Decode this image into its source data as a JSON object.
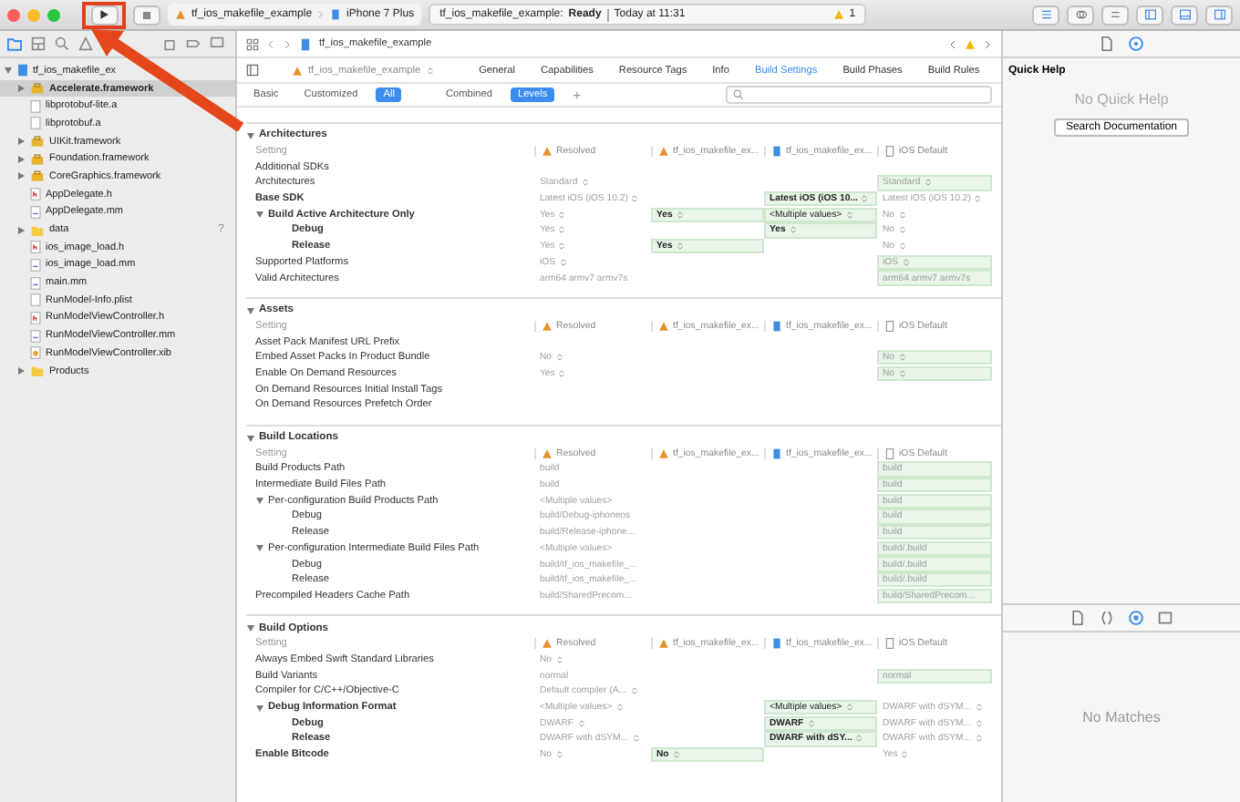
{
  "toolbar": {
    "scheme": "tf_ios_makefile_example",
    "device": "iPhone 7 Plus",
    "activity_project": "tf_ios_makefile_example:",
    "activity_status": "Ready",
    "activity_time": "Today at 11:31",
    "warning_count": "1"
  },
  "navigator_tabs": [
    {
      "kind": "folder",
      "selected": true
    },
    {
      "kind": "hierarchy",
      "selected": false
    },
    {
      "kind": "search",
      "selected": false
    },
    {
      "kind": "warning",
      "selected": false
    },
    {
      "kind": "debug",
      "selected": false
    },
    {
      "kind": "breakpoint",
      "selected": false
    },
    {
      "kind": "report",
      "selected": false
    }
  ],
  "project_tree": {
    "name": "tf_ios_makefile_ex",
    "kind": "project",
    "expanded": true,
    "selected": false,
    "children": [
      {
        "name": "Accelerate.framework",
        "kind": "framework",
        "expanded": false,
        "selected": true
      },
      {
        "name": "libprotobuf-lite.a",
        "kind": "file",
        "selected": false
      },
      {
        "name": "libprotobuf.a",
        "kind": "file",
        "selected": false
      },
      {
        "name": "UIKit.framework",
        "kind": "framework",
        "expanded": false,
        "selected": false
      },
      {
        "name": "Foundation.framework",
        "kind": "framework",
        "expanded": false,
        "selected": false
      },
      {
        "name": "CoreGraphics.framework",
        "kind": "framework",
        "expanded": false,
        "selected": false
      },
      {
        "name": "AppDelegate.h",
        "kind": "header",
        "selected": false
      },
      {
        "name": "AppDelegate.mm",
        "kind": "source",
        "selected": false
      },
      {
        "name": "data",
        "kind": "folder",
        "expanded": false,
        "selected": false,
        "badge": "?"
      },
      {
        "name": "ios_image_load.h",
        "kind": "header",
        "selected": false
      },
      {
        "name": "ios_image_load.mm",
        "kind": "source",
        "selected": false
      },
      {
        "name": "main.mm",
        "kind": "source",
        "selected": false
      },
      {
        "name": "RunModel-Info.plist",
        "kind": "file",
        "selected": false
      },
      {
        "name": "RunModelViewController.h",
        "kind": "header",
        "selected": false
      },
      {
        "name": "RunModelViewController.mm",
        "kind": "source",
        "selected": false
      },
      {
        "name": "RunModelViewController.xib",
        "kind": "xib",
        "selected": false
      },
      {
        "name": "Products",
        "kind": "folder",
        "expanded": false,
        "selected": false
      }
    ]
  },
  "editor": {
    "jump_path": "tf_ios_makefile_example",
    "target_selector": "tf_ios_makefile_example",
    "tabs": [
      {
        "label": "General",
        "selected": false
      },
      {
        "label": "Capabilities",
        "selected": false
      },
      {
        "label": "Resource Tags",
        "selected": false
      },
      {
        "label": "Info",
        "selected": false
      },
      {
        "label": "Build Settings",
        "selected": true
      },
      {
        "label": "Build Phases",
        "selected": false
      },
      {
        "label": "Build Rules",
        "selected": false
      }
    ],
    "scope_filters": [
      {
        "label": "Basic",
        "selected": false
      },
      {
        "label": "Customized",
        "selected": false
      },
      {
        "label": "All",
        "selected": true
      }
    ],
    "view_filters": [
      {
        "label": "Combined",
        "selected": false
      },
      {
        "label": "Levels",
        "selected": true
      }
    ],
    "add_button": "+",
    "sections": [
      {
        "title": "Architectures",
        "expanded": true,
        "header": {
          "setting": "Setting",
          "columns": [
            {
              "text": "Resolved",
              "kind": "resolved"
            },
            {
              "text": "tf_ios_makefile_ex...",
              "kind": "target"
            },
            {
              "text": "tf_ios_makefile_ex...",
              "kind": "project"
            },
            {
              "text": "iOS Default",
              "kind": "default"
            }
          ]
        },
        "rows": [
          {
            "name": "Additional SDKs",
            "bold": false,
            "cells": [
              null,
              null,
              null,
              null
            ]
          },
          {
            "name": "Architectures",
            "bold": false,
            "cells": [
              {
                "text": "Standard",
                "popup": true,
                "highlighted": false,
                "greyed": true,
                "bold": false
              },
              null,
              null,
              {
                "text": "Standard",
                "popup": true,
                "highlighted": true,
                "greyed": true,
                "bold": false
              }
            ]
          },
          {
            "name": "Base SDK",
            "bold": true,
            "cells": [
              {
                "text": "Latest iOS (iOS 10.2)",
                "popup": true,
                "highlighted": false,
                "greyed": true,
                "bold": false
              },
              null,
              {
                "text": "Latest iOS (iOS 10...",
                "popup": true,
                "highlighted": true,
                "greyed": false,
                "bold": true
              },
              {
                "text": "Latest iOS (iOS 10.2)",
                "popup": true,
                "highlighted": false,
                "greyed": true,
                "bold": false
              }
            ]
          },
          {
            "name": "Build Active Architecture Only",
            "bold": true,
            "expanded": true,
            "cells": [
              {
                "text": "Yes",
                "popup": true,
                "highlighted": false,
                "greyed": true,
                "bold": false
              },
              {
                "text": "Yes",
                "popup": true,
                "highlighted": true,
                "greyed": false,
                "bold": true
              },
              {
                "text": "<Multiple values>",
                "popup": true,
                "highlighted": true,
                "greyed": false,
                "bold": false
              },
              {
                "text": "No",
                "popup": true,
                "highlighted": false,
                "greyed": true,
                "bold": false
              }
            ],
            "children": [
              {
                "name": "Debug",
                "bold": true,
                "cells": [
                  {
                    "text": "Yes",
                    "popup": true,
                    "highlighted": false,
                    "greyed": true,
                    "bold": false
                  },
                  null,
                  {
                    "text": "Yes",
                    "popup": true,
                    "highlighted": true,
                    "greyed": false,
                    "bold": true
                  },
                  {
                    "text": "No",
                    "popup": true,
                    "highlighted": false,
                    "greyed": true,
                    "bold": false
                  }
                ]
              },
              {
                "name": "Release",
                "bold": true,
                "cells": [
                  {
                    "text": "Yes",
                    "popup": true,
                    "highlighted": false,
                    "greyed": true,
                    "bold": false
                  },
                  {
                    "text": "Yes",
                    "popup": true,
                    "highlighted": true,
                    "greyed": false,
                    "bold": true
                  },
                  null,
                  {
                    "text": "No",
                    "popup": true,
                    "highlighted": false,
                    "greyed": true,
                    "bold": false
                  }
                ]
              }
            ]
          },
          {
            "name": "Supported Platforms",
            "bold": false,
            "cells": [
              {
                "text": "iOS",
                "popup": true,
                "highlighted": false,
                "greyed": true,
                "bold": false
              },
              null,
              null,
              {
                "text": "iOS",
                "popup": true,
                "highlighted": true,
                "greyed": true,
                "bold": false
              }
            ]
          },
          {
            "name": "Valid Architectures",
            "bold": false,
            "cells": [
              {
                "text": "arm64 armv7 armv7s",
                "popup": false,
                "highlighted": false,
                "greyed": true,
                "bold": false
              },
              null,
              null,
              {
                "text": "arm64 armv7 armv7s",
                "popup": false,
                "highlighted": true,
                "greyed": true,
                "bold": false
              }
            ]
          }
        ]
      },
      {
        "title": "Assets",
        "expanded": true,
        "header": {
          "setting": "Setting",
          "columns": [
            {
              "text": "Resolved",
              "kind": "resolved"
            },
            {
              "text": "tf_ios_makefile_ex...",
              "kind": "target"
            },
            {
              "text": "tf_ios_makefile_ex...",
              "kind": "project"
            },
            {
              "text": "iOS Default",
              "kind": "default"
            }
          ]
        },
        "rows": [
          {
            "name": "Asset Pack Manifest URL Prefix",
            "bold": false,
            "cells": [
              null,
              null,
              null,
              null
            ]
          },
          {
            "name": "Embed Asset Packs In Product Bundle",
            "bold": false,
            "cells": [
              {
                "text": "No",
                "popup": true,
                "highlighted": false,
                "greyed": true,
                "bold": false
              },
              null,
              null,
              {
                "text": "No",
                "popup": true,
                "highlighted": true,
                "greyed": true,
                "bold": false
              }
            ]
          },
          {
            "name": "Enable On Demand Resources",
            "bold": false,
            "cells": [
              {
                "text": "Yes",
                "popup": true,
                "highlighted": false,
                "greyed": true,
                "bold": false
              },
              null,
              null,
              {
                "text": "No",
                "popup": true,
                "highlighted": true,
                "greyed": true,
                "bold": false
              }
            ]
          },
          {
            "name": "On Demand Resources Initial Install Tags",
            "bold": false,
            "cells": [
              null,
              null,
              null,
              null
            ]
          },
          {
            "name": "On Demand Resources Prefetch Order",
            "bold": false,
            "cells": [
              null,
              null,
              null,
              null
            ]
          }
        ]
      },
      {
        "title": "Build Locations",
        "expanded": true,
        "header": {
          "setting": "Setting",
          "columns": [
            {
              "text": "Resolved",
              "kind": "resolved"
            },
            {
              "text": "tf_ios_makefile_ex...",
              "kind": "target"
            },
            {
              "text": "tf_ios_makefile_ex...",
              "kind": "project"
            },
            {
              "text": "iOS Default",
              "kind": "default"
            }
          ]
        },
        "rows": [
          {
            "name": "Build Products Path",
            "bold": false,
            "cells": [
              {
                "text": "build",
                "popup": false,
                "highlighted": false,
                "greyed": true,
                "bold": false
              },
              null,
              null,
              {
                "text": "build",
                "popup": false,
                "highlighted": true,
                "greyed": true,
                "bold": false
              }
            ]
          },
          {
            "name": "Intermediate Build Files Path",
            "bold": false,
            "cells": [
              {
                "text": "build",
                "popup": false,
                "highlighted": false,
                "greyed": true,
                "bold": false
              },
              null,
              null,
              {
                "text": "build",
                "popup": false,
                "highlighted": true,
                "greyed": true,
                "bold": false
              }
            ]
          },
          {
            "name": "Per-configuration Build Products Path",
            "bold": false,
            "expanded": true,
            "cells": [
              {
                "text": "<Multiple values>",
                "popup": false,
                "highlighted": false,
                "greyed": true,
                "bold": false
              },
              null,
              null,
              {
                "text": "build",
                "popup": false,
                "highlighted": true,
                "greyed": true,
                "bold": false
              }
            ],
            "children": [
              {
                "name": "Debug",
                "bold": false,
                "cells": [
                  {
                    "text": "build/Debug-iphoneos",
                    "popup": false,
                    "highlighted": false,
                    "greyed": true,
                    "bold": false
                  },
                  null,
                  null,
                  {
                    "text": "build",
                    "popup": false,
                    "highlighted": true,
                    "greyed": true,
                    "bold": false
                  }
                ]
              },
              {
                "name": "Release",
                "bold": false,
                "cells": [
                  {
                    "text": "build/Release-iphone...",
                    "popup": false,
                    "highlighted": false,
                    "greyed": true,
                    "bold": false
                  },
                  null,
                  null,
                  {
                    "text": "build",
                    "popup": false,
                    "highlighted": true,
                    "greyed": true,
                    "bold": false
                  }
                ]
              }
            ]
          },
          {
            "name": "Per-configuration Intermediate Build Files Path",
            "bold": false,
            "expanded": true,
            "cells": [
              {
                "text": "<Multiple values>",
                "popup": false,
                "highlighted": false,
                "greyed": true,
                "bold": false
              },
              null,
              null,
              {
                "text": "build/.build",
                "popup": false,
                "highlighted": true,
                "greyed": true,
                "bold": false
              }
            ],
            "children": [
              {
                "name": "Debug",
                "bold": false,
                "cells": [
                  {
                    "text": "build/tf_ios_makefile_...",
                    "popup": false,
                    "highlighted": false,
                    "greyed": true,
                    "bold": false
                  },
                  null,
                  null,
                  {
                    "text": "build/.build",
                    "popup": false,
                    "highlighted": true,
                    "greyed": true,
                    "bold": false
                  }
                ]
              },
              {
                "name": "Release",
                "bold": false,
                "cells": [
                  {
                    "text": "build/tf_ios_makefile_...",
                    "popup": false,
                    "highlighted": false,
                    "greyed": true,
                    "bold": false
                  },
                  null,
                  null,
                  {
                    "text": "build/.build",
                    "popup": false,
                    "highlighted": true,
                    "greyed": true,
                    "bold": false
                  }
                ]
              }
            ]
          },
          {
            "name": "Precompiled Headers Cache Path",
            "bold": false,
            "cells": [
              {
                "text": "build/SharedPrecom...",
                "popup": false,
                "highlighted": false,
                "greyed": true,
                "bold": false
              },
              null,
              null,
              {
                "text": "build/SharedPrecom...",
                "popup": false,
                "highlighted": true,
                "greyed": true,
                "bold": false
              }
            ]
          }
        ]
      },
      {
        "title": "Build Options",
        "expanded": true,
        "header": {
          "setting": "Setting",
          "columns": [
            {
              "text": "Resolved",
              "kind": "resolved"
            },
            {
              "text": "tf_ios_makefile_ex...",
              "kind": "target"
            },
            {
              "text": "tf_ios_makefile_ex...",
              "kind": "project"
            },
            {
              "text": "iOS Default",
              "kind": "default"
            }
          ]
        },
        "rows": [
          {
            "name": "Always Embed Swift Standard Libraries",
            "bold": false,
            "cells": [
              {
                "text": "No",
                "popup": true,
                "highlighted": false,
                "greyed": true,
                "bold": false
              },
              null,
              null,
              null
            ]
          },
          {
            "name": "Build Variants",
            "bold": false,
            "cells": [
              {
                "text": "normal",
                "popup": false,
                "highlighted": false,
                "greyed": true,
                "bold": false
              },
              null,
              null,
              {
                "text": "normal",
                "popup": false,
                "highlighted": true,
                "greyed": true,
                "bold": false
              }
            ]
          },
          {
            "name": "Compiler for C/C++/Objective-C",
            "bold": false,
            "cells": [
              {
                "text": "Default compiler (A...",
                "popup": true,
                "highlighted": false,
                "greyed": true,
                "bold": false
              },
              null,
              null,
              null
            ]
          },
          {
            "name": "Debug Information Format",
            "bold": true,
            "expanded": true,
            "cells": [
              {
                "text": "<Multiple values>",
                "popup": true,
                "highlighted": false,
                "greyed": true,
                "bold": false
              },
              null,
              {
                "text": "<Multiple values>",
                "popup": true,
                "highlighted": true,
                "greyed": false,
                "bold": false
              },
              {
                "text": "DWARF with dSYM...",
                "popup": true,
                "highlighted": false,
                "greyed": true,
                "bold": false
              }
            ],
            "children": [
              {
                "name": "Debug",
                "bold": true,
                "cells": [
                  {
                    "text": "DWARF",
                    "popup": true,
                    "highlighted": false,
                    "greyed": true,
                    "bold": false
                  },
                  null,
                  {
                    "text": "DWARF",
                    "popup": true,
                    "highlighted": true,
                    "greyed": false,
                    "bold": true
                  },
                  {
                    "text": "DWARF with dSYM...",
                    "popup": true,
                    "highlighted": false,
                    "greyed": true,
                    "bold": false
                  }
                ]
              },
              {
                "name": "Release",
                "bold": true,
                "cells": [
                  {
                    "text": "DWARF with dSYM...",
                    "popup": true,
                    "highlighted": false,
                    "greyed": true,
                    "bold": false
                  },
                  null,
                  {
                    "text": "DWARF with dSY...",
                    "popup": true,
                    "highlighted": true,
                    "greyed": false,
                    "bold": true
                  },
                  {
                    "text": "DWARF with dSYM...",
                    "popup": true,
                    "highlighted": false,
                    "greyed": true,
                    "bold": false
                  }
                ]
              }
            ]
          },
          {
            "name": "Enable Bitcode",
            "bold": true,
            "cells": [
              {
                "text": "No",
                "popup": true,
                "highlighted": false,
                "greyed": true,
                "bold": false
              },
              {
                "text": "No",
                "popup": true,
                "highlighted": true,
                "greyed": false,
                "bold": true
              },
              null,
              {
                "text": "Yes",
                "popup": true,
                "highlighted": false,
                "greyed": true,
                "bold": false
              }
            ]
          }
        ]
      }
    ]
  },
  "inspector": {
    "tabs": [
      {
        "kind": "file",
        "selected": false
      },
      {
        "kind": "help",
        "selected": true
      }
    ],
    "title": "Quick Help",
    "empty_message": "No Quick Help",
    "button": "Search Documentation",
    "library_tabs": [
      {
        "kind": "file",
        "selected": false
      },
      {
        "kind": "braces",
        "selected": false
      },
      {
        "kind": "object",
        "selected": true
      },
      {
        "kind": "media",
        "selected": false
      }
    ],
    "library_message": "No Matches"
  }
}
